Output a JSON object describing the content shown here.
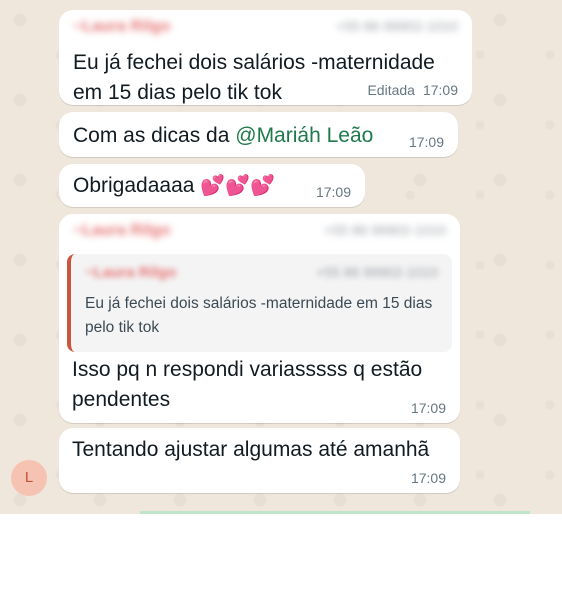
{
  "messages": [
    {
      "sender_name": "~Laura Rilgo",
      "sender_phone": "+55 86 99902-1010",
      "text": "Eu já fechei dois salários -maternidade em 15 dias pelo tik tok",
      "edited_label": "Editada",
      "time": "17:09"
    },
    {
      "text_prefix": "Com as dicas da ",
      "mention": "@Mariáh Leão",
      "time": "17:09"
    },
    {
      "text": "Obrigadaaaa",
      "emoji": "💕💕💕",
      "time": "17:09"
    },
    {
      "sender_name": "~Laura Rilgo",
      "sender_phone": "+55 86 99902-1010",
      "quote": {
        "sender_name": "~Laura Rilgo",
        "sender_phone": "+55 86 99902-1010",
        "text": "Eu já fechei dois salários -maternidade em 15 dias pelo tik tok"
      },
      "text": "Isso pq n respondi variasssss q estão pendentes",
      "time": "17:09"
    },
    {
      "text": "Tentando ajustar algumas até amanhã",
      "time": "17:09"
    }
  ],
  "avatar": {
    "initial": "L",
    "bg_color": "#f6c2b1"
  },
  "colors": {
    "chat_bg": "#efe7dc",
    "bubble_bg": "#ffffff",
    "mention": "#1f7a4a",
    "quote_bar": "#c9573f",
    "sender": "#e57373"
  }
}
